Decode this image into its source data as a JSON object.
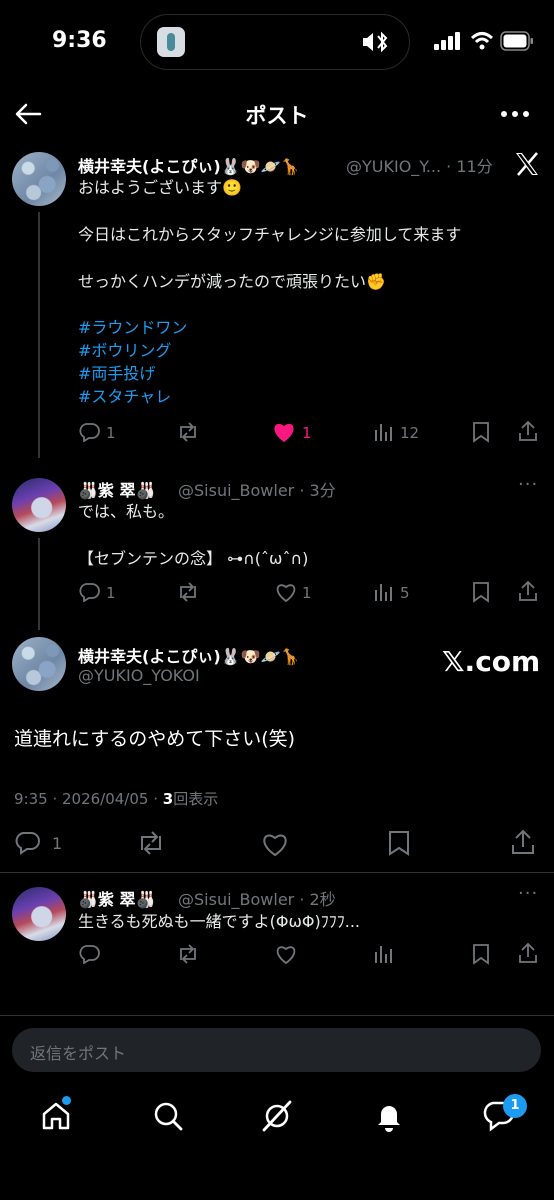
{
  "status_bar": {
    "time": "9:36"
  },
  "header": {
    "title": "ポスト"
  },
  "post1": {
    "name": "横井幸夫(よこぴぃ)🐰🐶🪐🦒",
    "handle_time": "@YUKIO_Y... · 11分",
    "lines": [
      "おはようございます🙂",
      "今日はこれからスタッフチャレンジに参加して来ます",
      "せっかくハンデが減ったので頑張りたい✊"
    ],
    "hashtags": [
      "#ラウンドワン",
      "#ボウリング",
      "#両手投げ",
      "#スタチャレ"
    ],
    "actions": {
      "replies": "1",
      "likes": "1",
      "views": "12"
    }
  },
  "post2": {
    "name": "🎳紫 翠🎳",
    "handle_time": "@Sisui_Bowler · 3分",
    "lines": [
      "では、私も。",
      "【セブンテンの念】 ⊶∩(ˆωˆ∩)"
    ],
    "actions": {
      "replies": "1",
      "likes": "1",
      "views": "5"
    }
  },
  "main_post": {
    "name": "横井幸夫(よこぴぃ)🐰🐶🪐🦒",
    "handle": "@YUKIO_YOKOI",
    "brand": "𝕏.com",
    "text": "道連れにするのやめて下さい(笑)",
    "timestamp": "9:35 · 2026/04/05 · ",
    "views_count": "3",
    "views_label": "回表示",
    "replies": "1"
  },
  "reply": {
    "name": "🎳紫 翠🎳",
    "handle_time": "@Sisui_Bowler · 2秒",
    "text": "生きるも死ぬも一緒ですよ(ΦωΦ)ﾌﾌﾌ..."
  },
  "compose": {
    "placeholder": "返信をポスト"
  },
  "tab_bar": {
    "notification_badge": "1"
  },
  "colors": {
    "accent": "#1d9bf0",
    "like": "#f91880",
    "muted": "#71767b"
  }
}
